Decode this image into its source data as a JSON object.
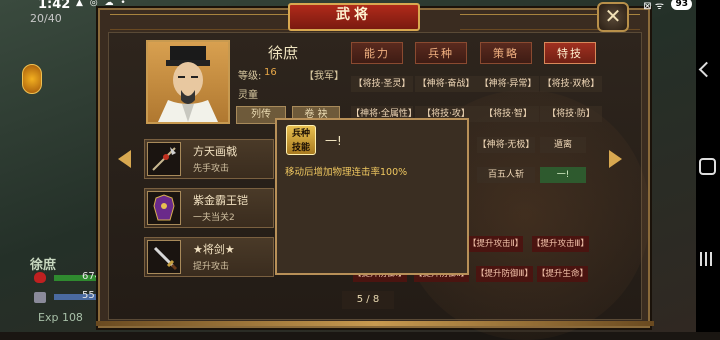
{
  "status_bar": {
    "time": "1:42",
    "icons": "▲ ◎ ☁ •",
    "right_icons": "⊠ ᯤ",
    "battery": "93"
  },
  "background": {
    "counter": "20/40",
    "unit_name": "徐庶",
    "hp_value": "674",
    "mp_value": "55",
    "exp_text": "Exp 108"
  },
  "panel": {
    "title": "武将"
  },
  "hero": {
    "name": "徐庶",
    "level_label": "等级:",
    "level_value": "16",
    "side": "【我军】",
    "spirit": "灵童",
    "btn1": "列传",
    "btn2": "卷 袂"
  },
  "items": [
    {
      "name": "方天画戟",
      "desc": "先手攻击",
      "icon": "halberd-icon"
    },
    {
      "name": "紫金霸王铠",
      "desc": "一夫当关2",
      "icon": "armor-icon"
    },
    {
      "name": "★将剑★",
      "desc": "提升攻击",
      "icon": "sword-icon"
    }
  ],
  "tabs": [
    "能力",
    "兵种",
    "策略",
    "特技"
  ],
  "skills_row1": [
    "【将技·圣灵】",
    "【神将·奋战】",
    "【神将·异常】",
    "【将技·双枪】"
  ],
  "skills_row2": [
    "【神将·全属性】",
    "【将技·攻】",
    "【将技·智】",
    "【将技·防】"
  ],
  "skills_row3": [
    "【神将·无极】",
    "遁离"
  ],
  "skills_row4": [
    "百五人斩",
    "一!"
  ],
  "skills_red1": [
    "【提升攻击Ⅱ】",
    "【提升攻击Ⅲ】"
  ],
  "skills_red2": [
    "【提升防御Ⅰ】",
    "【提升防御Ⅱ】",
    "【提升防御Ⅲ】",
    "【提升生命】"
  ],
  "tooltip": {
    "badge_line1": "兵种",
    "badge_line2": "技能",
    "title": "一!",
    "desc": "移动后增加物理连击率100%"
  },
  "page": "5 / 8",
  "colors": {
    "gold": "#d8a850",
    "title_red": "#b02a1a",
    "tooltip_text": "#f0c860",
    "level_orange": "#e8a848"
  }
}
